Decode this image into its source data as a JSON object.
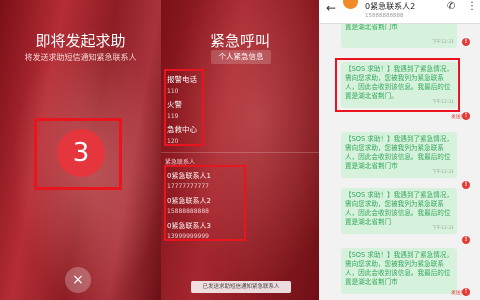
{
  "countdown": {
    "title": "即将发起求助",
    "subtitle": "将发送求助短信通知紧急联系人",
    "number": "3",
    "close_glyph": "×"
  },
  "emergency": {
    "title": "紧急呼叫",
    "info_button": "个人紧急信息",
    "services": [
      {
        "name": "报警电话",
        "number": "110"
      },
      {
        "name": "火警",
        "number": "119"
      },
      {
        "name": "急救中心",
        "number": "120"
      }
    ],
    "contacts_label": "紧急联系人",
    "contacts": [
      {
        "name": "0紧急联系人1",
        "number": "17777777777"
      },
      {
        "name": "0紧急联系人2",
        "number": "15888888888"
      },
      {
        "name": "0紧急联系人3",
        "number": "13999999999"
      }
    ],
    "toast": "已发送求助短信通知紧急联系人"
  },
  "chat": {
    "contact_name": "0紧急联系人2",
    "contact_number": "15888888888",
    "back_glyph": "←",
    "phone_glyph": "✆",
    "more_glyph": "⋮",
    "failed_label": "发送失败",
    "messages": [
      {
        "text": "紧急联系人，您被我列为紧急联系人，因此会收到该信息。我最后的位置是湖北省荆门市",
        "time": "下午12:31"
      },
      {
        "text": "【SOS 求助！】我遇到了紧急情况，需向您求助，您被我列为紧急联系人，因此会收到该信息。我最后的位置是湖北省荆门。",
        "time": "下午12:31"
      },
      {
        "text": "【SOS 求助！】我遇到了紧急情况，需向您求助，您被我列为紧急联系人，因此会收到该信息。我最后的位置是湖北省荆门市",
        "time": "下午12:31"
      },
      {
        "text": "【SOS 求助！】我遇到了紧急情况，需向您求助，您被我列为紧急联系人，因此会收到该信息。我最后的位置是湖北省荆门",
        "time": "下午12:31"
      },
      {
        "text": "【SOS 求助！】我遇到了紧急情况，需向您求助，您被我列为紧急联系人，因此会收到该信息。我最后的位置是湖北省荆门市",
        "time": ""
      }
    ]
  },
  "colors": {
    "highlight_red": "#e8151e",
    "sms_green_text": "#2fa65a",
    "sms_bubble": "#d7f2dc",
    "error_red": "#e43b35"
  },
  "icons": [
    "close-icon",
    "back-arrow-icon",
    "phone-icon",
    "more-icon",
    "error-icon",
    "avatar"
  ]
}
